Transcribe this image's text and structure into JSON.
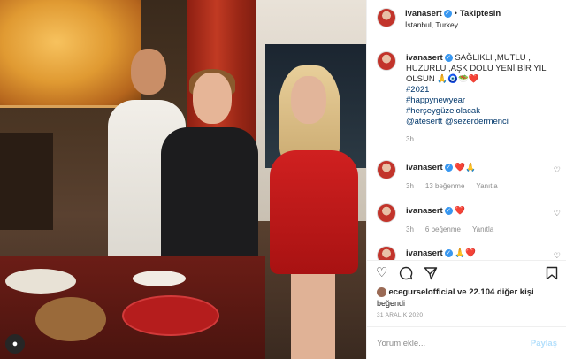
{
  "post": {
    "username": "ivanasert",
    "verified": true,
    "follow_label": "Takiptesin",
    "location": "İstanbul, Turkey"
  },
  "caption": {
    "username": "ivanasert",
    "text": "SAĞLIKLI ,MUTLU , HUZURLU ,AŞK DOLU YENİ BİR YIL OLSUN 🙏🧿🥗❤️",
    "hashtags": [
      "#2021",
      "#happynewyear",
      "#herşeygüzelolacak"
    ],
    "mentions": "@atesertt @sezerdermenci",
    "time": "3h"
  },
  "comments": [
    {
      "username": "ivanasert",
      "text": "❤️🙏",
      "time": "3h",
      "likes": "13 beğenme",
      "reply": "Yanıtla"
    },
    {
      "username": "ivanasert",
      "text": "❤️",
      "time": "3h",
      "likes": "6 beğenme",
      "reply": "Yanıtla"
    },
    {
      "username": "ivanasert",
      "text": "🙏❤️",
      "time": "",
      "likes": "",
      "reply": ""
    }
  ],
  "actions": {
    "like": "like-icon",
    "comment": "comment-icon",
    "share": "share-icon",
    "save": "save-icon"
  },
  "likes": {
    "liker": "ecegurselofficial",
    "rest": "ve 22.104 diğer kişi",
    "line2": "beğendi"
  },
  "date": "31 ARALIK 2020",
  "comment_input": {
    "placeholder": "Yorum ekle...",
    "post_label": "Paylaş"
  },
  "colors": {
    "link": "#00376b",
    "verified": "#3897f0",
    "muted": "#8e8e8e",
    "post_disabled": "#b2dffc"
  }
}
